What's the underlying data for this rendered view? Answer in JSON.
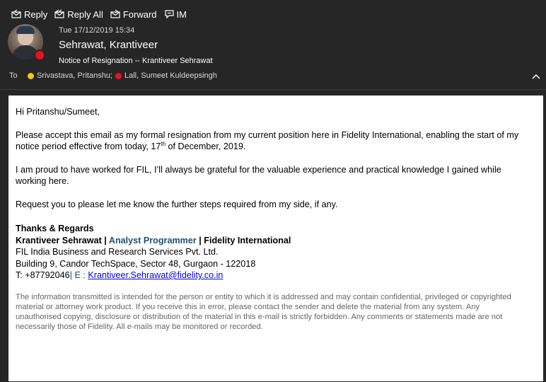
{
  "toolbar": {
    "reply_label": "Reply",
    "reply_all_label": "Reply All",
    "forward_label": "Forward",
    "im_label": "IM"
  },
  "message": {
    "date": "Tue 17/12/2019 15:34",
    "sender": "Sehrawat, Krantiveer",
    "subject": "Notice of Resignation -- Krantiveer Sehrawat",
    "to_label": "To",
    "recipients": [
      {
        "name": "Srivastava, Pritanshu;",
        "status_color": "#f2c811"
      },
      {
        "name": "Lall, Sumeet Kuldeepsingh",
        "status_color": "#e81123"
      }
    ],
    "sender_status_color": "#e81123"
  },
  "body": {
    "greeting": "Hi Pritanshu/Sumeet,",
    "para1_a": "Please accept this email as my formal resignation from my current position here in Fidelity International, enabling the start of my notice period effective from today, 17",
    "para1_sup": "th",
    "para1_b": " of December, 2019.",
    "para2": "I am proud to have worked for FIL,  I’ll always be grateful for the valuable experience and practical knowledge I gained while working here.",
    "para3": "Request you to please let me know the further steps required from my side, if any."
  },
  "signature": {
    "thanks": "Thanks & Regards",
    "name": "Krantiveer Sehrawat",
    "sep": " | ",
    "title": "Analyst Programmer",
    "company": "Fidelity International",
    "org": "FIL India Business and Research Services Pvt. Ltd.",
    "address": "Building 9, Candor TechSpace, Sector 48, Gurgaon - 122018",
    "phone": "T: +87792046",
    "email_label": "| E : ",
    "email": "Krantiveer.Sehrawat@fidelity.co.in"
  },
  "disclaimer": "The information transmitted is intended for the person or entity to which it is addressed and may contain confidential, privileged or copyrighted material or attorney work product. If you receive this in error, please contact the sender and delete the material from any system. Any unauthorised copying, disclosure or distribution of the material in this e-mail is strictly forbidden. Any comments or statements made are not necessarily those of Fidelity. All e-mails may be monitored or recorded."
}
